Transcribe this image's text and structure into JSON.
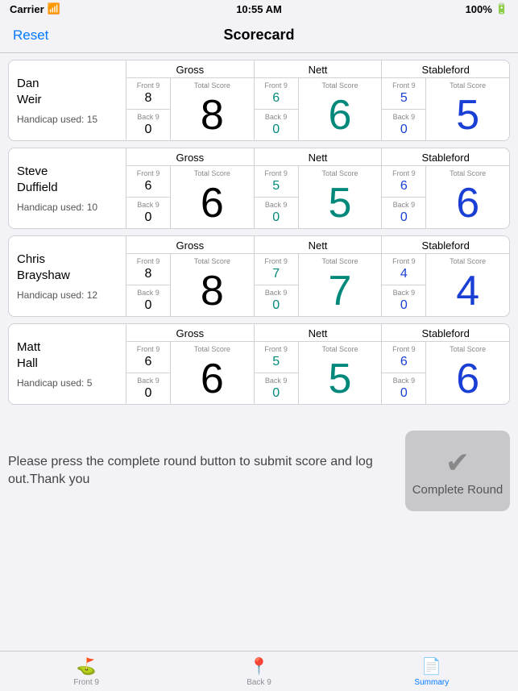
{
  "statusBar": {
    "carrier": "Carrier",
    "time": "10:55 AM",
    "battery": "100%"
  },
  "navBar": {
    "resetLabel": "Reset",
    "title": "Scorecard"
  },
  "players": [
    {
      "id": "player-1",
      "name1": "Dan",
      "name2": "Weir",
      "handicap": "Handicap used: 15",
      "gross": {
        "header": "Gross",
        "front9Label": "Front 9",
        "front9Value": "8",
        "back9Label": "Back 9",
        "back9Value": "0",
        "totalLabel": "Total Score",
        "totalValue": "8"
      },
      "nett": {
        "header": "Nett",
        "front9Label": "Front 9",
        "front9Value": "6",
        "back9Label": "Back 9",
        "back9Value": "0",
        "totalLabel": "Total Score",
        "totalValue": "6"
      },
      "stableford": {
        "header": "Stableford",
        "front9Label": "Front 9",
        "front9Value": "5",
        "back9Label": "Back 9",
        "back9Value": "0",
        "totalLabel": "Total Score",
        "totalValue": "5"
      }
    },
    {
      "id": "player-2",
      "name1": "Steve",
      "name2": "Duffield",
      "handicap": "Handicap used: 10",
      "gross": {
        "header": "Gross",
        "front9Label": "Front 9",
        "front9Value": "6",
        "back9Label": "Back 9",
        "back9Value": "0",
        "totalLabel": "Total Score",
        "totalValue": "6"
      },
      "nett": {
        "header": "Nett",
        "front9Label": "Front 9",
        "front9Value": "5",
        "back9Label": "Back 9",
        "back9Value": "0",
        "totalLabel": "Total Score",
        "totalValue": "5"
      },
      "stableford": {
        "header": "Stableford",
        "front9Label": "Front 9",
        "front9Value": "6",
        "back9Label": "Back 9",
        "back9Value": "0",
        "totalLabel": "Total Score",
        "totalValue": "6"
      }
    },
    {
      "id": "player-3",
      "name1": "Chris",
      "name2": "Brayshaw",
      "handicap": "Handicap used: 12",
      "gross": {
        "header": "Gross",
        "front9Label": "Front 9",
        "front9Value": "8",
        "back9Label": "Back 9",
        "back9Value": "0",
        "totalLabel": "Total Score",
        "totalValue": "8"
      },
      "nett": {
        "header": "Nett",
        "front9Label": "Front 9",
        "front9Value": "7",
        "back9Label": "Back 9",
        "back9Value": "0",
        "totalLabel": "Total Score",
        "totalValue": "7"
      },
      "stableford": {
        "header": "Stableford",
        "front9Label": "Front 9",
        "front9Value": "4",
        "back9Label": "Back 9",
        "back9Value": "0",
        "totalLabel": "Total Score",
        "totalValue": "4"
      }
    },
    {
      "id": "player-4",
      "name1": "Matt",
      "name2": "Hall",
      "handicap": "Handicap used: 5",
      "gross": {
        "header": "Gross",
        "front9Label": "Front 9",
        "front9Value": "6",
        "back9Label": "Back 9",
        "back9Value": "0",
        "totalLabel": "Total Score",
        "totalValue": "6"
      },
      "nett": {
        "header": "Nett",
        "front9Label": "Front 9",
        "front9Value": "5",
        "back9Label": "Back 9",
        "back9Value": "0",
        "totalLabel": "Total Score",
        "totalValue": "5"
      },
      "stableford": {
        "header": "Stableford",
        "front9Label": "Front 9",
        "front9Value": "6",
        "back9Label": "Back 9",
        "back9Value": "0",
        "totalLabel": "Total Score",
        "totalValue": "6"
      }
    }
  ],
  "bottomSection": {
    "message": "Please press the complete round button to submit score and log out.Thank you",
    "buttonLabel": "Complete Round"
  },
  "tabBar": {
    "tabs": [
      {
        "id": "front9",
        "label": "Front 9",
        "icon": "⛳",
        "active": false
      },
      {
        "id": "back9",
        "label": "Back 9",
        "icon": "📍",
        "active": false
      },
      {
        "id": "summary",
        "label": "Summary",
        "icon": "📋",
        "active": true
      }
    ]
  }
}
